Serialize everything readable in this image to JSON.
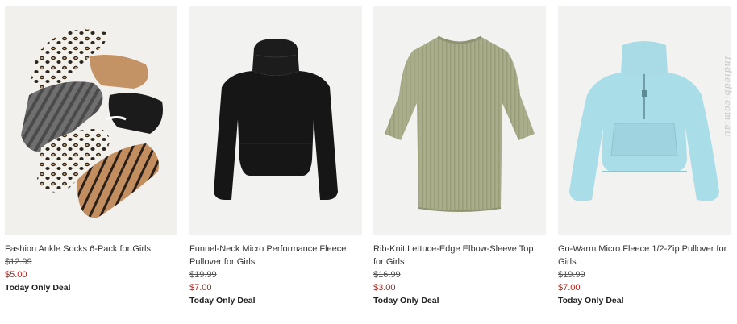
{
  "products": [
    {
      "name": "Fashion Ankle Socks 6-Pack for Girls",
      "was_price": "$12.99",
      "now_price": "$5.00",
      "badge": "Today Only Deal",
      "image_icon": "socks-image"
    },
    {
      "name": "Funnel-Neck Micro Performance Fleece Pullover for Girls",
      "was_price": "$19.99",
      "now_price": "$7.00",
      "badge": "Today Only Deal",
      "image_icon": "black-pullover-image"
    },
    {
      "name": "Rib-Knit Lettuce-Edge Elbow-Sleeve Top for Girls",
      "was_price": "$16.99",
      "now_price": "$3.00",
      "badge": "Today Only Deal",
      "image_icon": "green-top-image"
    },
    {
      "name": "Go-Warm Micro Fleece 1/2-Zip Pullover for Girls",
      "was_price": "$19.99",
      "now_price": "$7.00",
      "badge": "Today Only Deal",
      "image_icon": "blue-pullover-image"
    }
  ],
  "watermark": "Indiedb.com.au",
  "colors": {
    "sale_price": "#b0251e",
    "text": "#333333",
    "image_bg": "#f3f2f0"
  }
}
